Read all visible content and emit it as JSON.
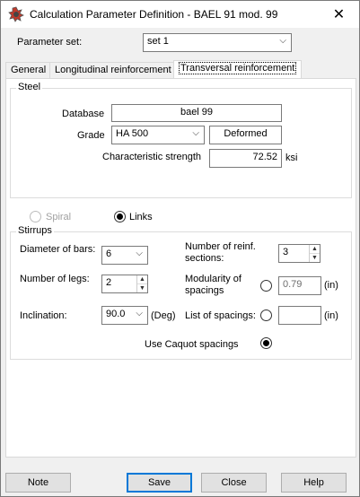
{
  "window": {
    "title": "Calculation Parameter Definition - BAEL 91 mod. 99",
    "close_glyph": "✕"
  },
  "parameter_set": {
    "label": "Parameter set:",
    "value": "set 1"
  },
  "tabs": [
    {
      "label": "General"
    },
    {
      "label": "Longitudinal reinforcement"
    },
    {
      "label": "Transversal reinforcement"
    }
  ],
  "steel": {
    "group_title": "Steel",
    "database_label": "Database",
    "database_value": "bael 99",
    "grade_label": "Grade",
    "grade_value": "HA 500",
    "grade_type": "Deformed",
    "char_strength_label": "Characteristic strength",
    "char_strength_value": "72.52",
    "char_strength_unit": "ksi"
  },
  "type_selection": {
    "spiral_label": "Spiral",
    "links_label": "Links"
  },
  "stirrups": {
    "group_title": "Stirrups",
    "diameter_label": "Diameter of bars:",
    "diameter_value": "6",
    "legs_label": "Number of legs:",
    "legs_value": "2",
    "inclination_label": "Inclination:",
    "inclination_value": "90.0",
    "inclination_unit": "(Deg)",
    "reinf_sections_label_1": "Number of reinf.",
    "reinf_sections_label_2": "sections:",
    "reinf_sections_value": "3",
    "modularity_label_1": "Modularity of",
    "modularity_label_2": "spacings",
    "modularity_value": "0.79",
    "modularity_unit": "(in)",
    "list_spacings_label": "List of spacings:",
    "list_spacings_value": "",
    "list_spacings_unit": "(in)",
    "caquot_label": "Use Caquot spacings"
  },
  "buttons": {
    "note": "Note",
    "save": "Save",
    "close": "Close",
    "help": "Help"
  },
  "icons": {
    "chevron": "⌵",
    "spin_up": "▲",
    "spin_down": "▼"
  }
}
